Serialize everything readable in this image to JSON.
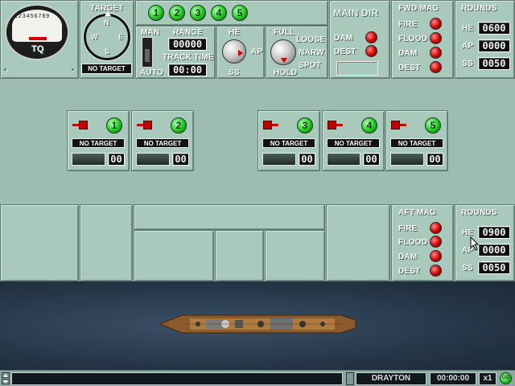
{
  "gauge": {
    "label": "TQ",
    "scale": [
      "1",
      "2",
      "3",
      "4",
      "5",
      "6",
      "7",
      "8",
      "9"
    ]
  },
  "target": {
    "title": "TARGET",
    "compass": {
      "n": "N",
      "s": "S",
      "e": "E",
      "w": "W"
    },
    "status": "NO TARGET"
  },
  "turret_buttons": [
    "1",
    "2",
    "3",
    "4",
    "5"
  ],
  "fire_control": {
    "man": "MAN",
    "auto": "AUTO",
    "range_label": "RANGE",
    "range_value": "00000",
    "track_label": "TRACK TIME",
    "track_value": "00:00"
  },
  "ammo_select": {
    "he": "HE",
    "ap": "AP",
    "ss": "SS"
  },
  "speed_select": {
    "full": "FULL",
    "loose": "LOOSE",
    "narrow": "NARW",
    "spot": "SPOT",
    "hold": "HOLD"
  },
  "main_dir": {
    "title": "MAIN DIR",
    "dam": "DAM",
    "dest": "DEST"
  },
  "fwd_mag": {
    "title": "FWD MAG",
    "items": [
      "FIRE",
      "FLOOD",
      "DAM",
      "DEST"
    ]
  },
  "fwd_rounds": {
    "title": "ROUNDS",
    "rows": [
      {
        "type": "HE",
        "value": "0600"
      },
      {
        "type": "AP",
        "value": "0000"
      },
      {
        "type": "SS",
        "value": "0050"
      }
    ]
  },
  "turrets": [
    {
      "number": "1",
      "status": "NO TARGET",
      "count": "00"
    },
    {
      "number": "2",
      "status": "NO TARGET",
      "count": "00"
    },
    {
      "number": "3",
      "status": "NO TARGET",
      "count": "00"
    },
    {
      "number": "4",
      "status": "NO TARGET",
      "count": "00"
    },
    {
      "number": "5",
      "status": "NO TARGET",
      "count": "00"
    }
  ],
  "aft_mag": {
    "title": "AFT MAG",
    "items": [
      "FIRE",
      "FLOOD",
      "DAM",
      "DEST"
    ]
  },
  "aft_rounds": {
    "title": "ROUNDS",
    "rows": [
      {
        "type": "HE",
        "value": "0900"
      },
      {
        "type": "AP",
        "value": "0000"
      },
      {
        "type": "SS",
        "value": "0050"
      }
    ]
  },
  "status_bar": {
    "ship": "DRAYTON",
    "time": "00:00:00",
    "speed": "x1",
    "go": "GO"
  },
  "colors": {
    "panel": "#a9c9bd",
    "lamp_red": "#cc0000",
    "lamp_green": "#1ec81e"
  }
}
